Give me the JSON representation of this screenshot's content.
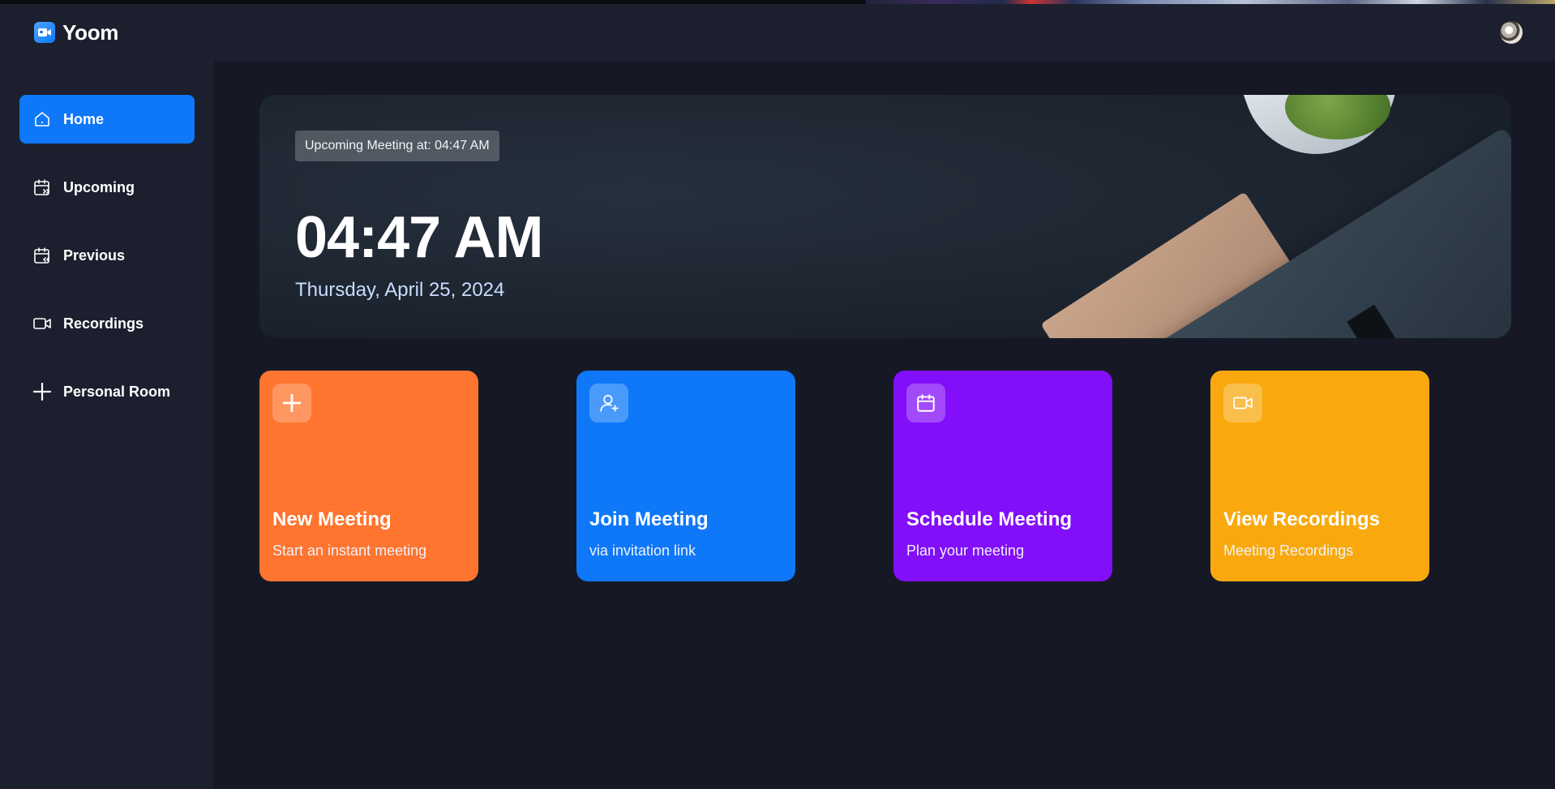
{
  "app": {
    "name": "Yoom",
    "logo_icon": "video-camera-logo-icon",
    "avatar_icon": "user-avatar-icon"
  },
  "sidebar": {
    "items": [
      {
        "label": "Home",
        "icon": "home-icon",
        "active": true
      },
      {
        "label": "Upcoming",
        "icon": "calendar-forward-icon",
        "active": false
      },
      {
        "label": "Previous",
        "icon": "calendar-back-icon",
        "active": false
      },
      {
        "label": "Recordings",
        "icon": "video-icon",
        "active": false
      },
      {
        "label": "Personal Room",
        "icon": "plus-icon",
        "active": false
      }
    ]
  },
  "hero": {
    "upcoming_badge": "Upcoming Meeting at: 04:47 AM",
    "time": "04:47 AM",
    "date": "Thursday, April 25, 2024"
  },
  "cards": [
    {
      "title": "New Meeting",
      "subtitle": "Start an instant meeting",
      "icon": "plus-icon",
      "color": "#ff742e"
    },
    {
      "title": "Join Meeting",
      "subtitle": "via invitation link",
      "icon": "add-user-icon",
      "color": "#0e78f9"
    },
    {
      "title": "Schedule Meeting",
      "subtitle": "Plan your meeting",
      "icon": "calendar-icon",
      "color": "#830ef9"
    },
    {
      "title": "View Recordings",
      "subtitle": "Meeting Recordings",
      "icon": "video-icon",
      "color": "#f9a90e"
    }
  ],
  "colors": {
    "background": "#161925",
    "panel": "#1c1f2e",
    "accent": "#0e78f9"
  }
}
